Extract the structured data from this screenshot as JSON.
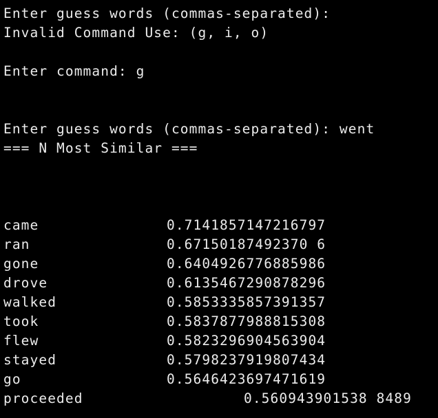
{
  "terminal": {
    "lines": [
      "Enter guess words (commas-separated):",
      "Invalid Command Use: (g, i, o)",
      "",
      "Enter command: g",
      "",
      "",
      "Enter guess words (commas-separated): went",
      "=== N Most Similar ==="
    ],
    "results": [
      {
        "word": "came",
        "score": "0.7141857147216797"
      },
      {
        "word": "ran",
        "score": "0.67150187492370 6"
      },
      {
        "word": "gone",
        "score": "0.6404926776885986"
      },
      {
        "word": "drove",
        "score": "0.6135467290878296"
      },
      {
        "word": "walked",
        "score": "0.5853335857391357"
      },
      {
        "word": "took",
        "score": "0.5837877988815308"
      },
      {
        "word": "flew",
        "score": "0.5823296904563904"
      },
      {
        "word": "stayed",
        "score": "0.5798237919807434"
      },
      {
        "word": "go",
        "score": "0.5646423697471619"
      },
      {
        "word": "proceeded",
        "score": "0.560943901538 8489"
      }
    ]
  },
  "colors": {
    "background": "#000000",
    "text": "#ECECEC"
  }
}
